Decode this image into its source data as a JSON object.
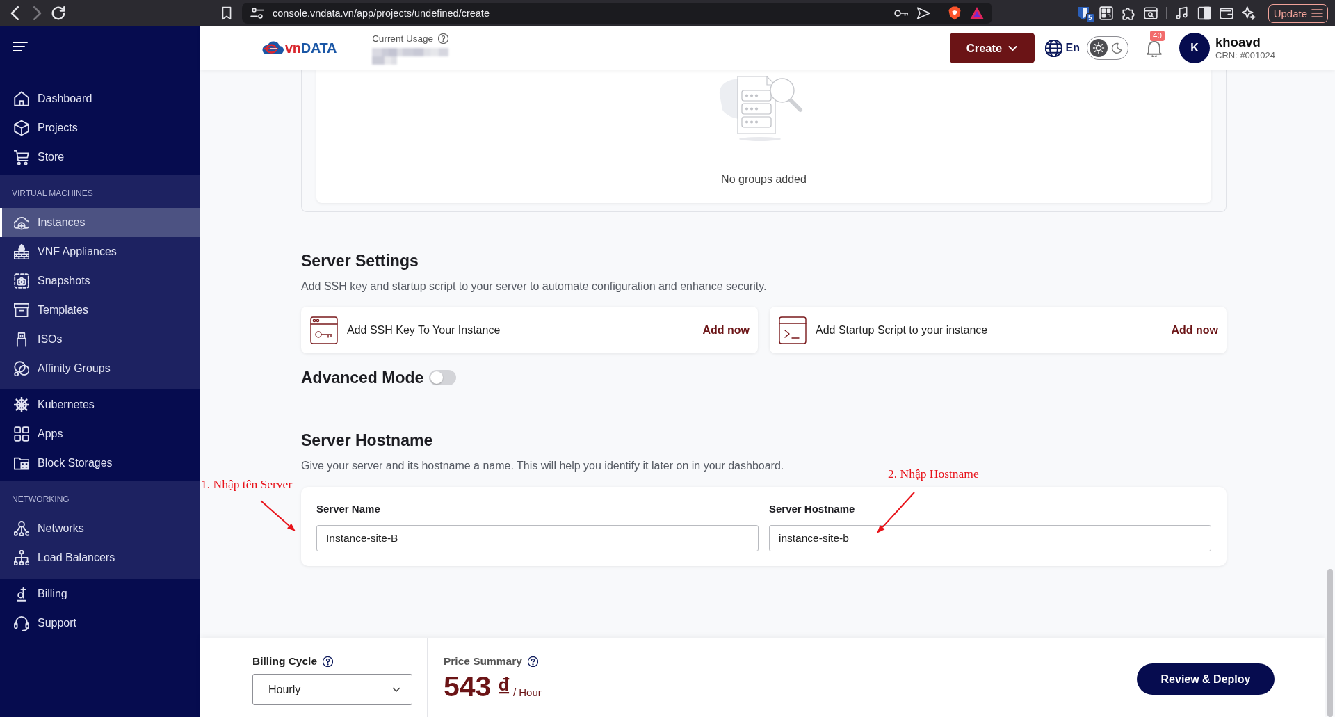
{
  "browser": {
    "nav": [
      {
        "kind": "back",
        "disabled": false
      },
      {
        "kind": "forward",
        "disabled": true
      },
      {
        "kind": "reload",
        "disabled": false
      }
    ],
    "url": "console.vndata.vn/app/projects/undefined/create",
    "extension_badge": "5",
    "update_button": "Update"
  },
  "header": {
    "logo_text": "vnDATA",
    "usage_label": "Current Usage",
    "create_button": "Create",
    "language": "En",
    "theme": [
      {
        "kind": "light",
        "selected": true
      },
      {
        "kind": "dark",
        "selected": false
      }
    ],
    "notification_count": "40",
    "user": {
      "initial": "K",
      "name": "khoavd",
      "crn": "CRN: #001024"
    }
  },
  "sidebar": {
    "groups": [
      {
        "items": [
          {
            "label": "Dashboard",
            "selected": false
          },
          {
            "label": "Projects",
            "selected": false
          },
          {
            "label": "Store",
            "selected": false
          }
        ]
      },
      {
        "title": "VIRTUAL MACHINES",
        "items": [
          {
            "label": "Instances",
            "selected": true
          },
          {
            "label": "VNF Appliances",
            "selected": false
          },
          {
            "label": "Snapshots",
            "selected": false
          },
          {
            "label": "Templates",
            "selected": false
          },
          {
            "label": "ISOs",
            "selected": false
          },
          {
            "label": "Affinity Groups",
            "selected": false
          }
        ]
      },
      {
        "items": [
          {
            "label": "Kubernetes",
            "selected": false
          },
          {
            "label": "Apps",
            "selected": false
          },
          {
            "label": "Block Storages",
            "selected": false
          }
        ]
      },
      {
        "title": "NETWORKING",
        "items": [
          {
            "label": "Networks",
            "selected": false
          },
          {
            "label": "Load Balancers",
            "selected": false
          }
        ]
      },
      {
        "items": [
          {
            "label": "Billing",
            "selected": false
          },
          {
            "label": "Support",
            "selected": false
          }
        ]
      }
    ]
  },
  "groups_panel": {
    "empty_text": "No groups added"
  },
  "server_settings": {
    "title": "Server Settings",
    "description": "Add SSH key and startup script to your server to automate configuration and enhance security.",
    "cards": [
      {
        "label": "Add SSH Key To Your Instance",
        "action": "Add now"
      },
      {
        "label": "Add Startup Script to your instance",
        "action": "Add now"
      }
    ],
    "advanced_mode": {
      "label": "Advanced Mode",
      "on": false
    }
  },
  "server_hostname": {
    "title": "Server Hostname",
    "description": "Give your server and its hostname a name. This will help you identify it later on in your dashboard.",
    "fields": [
      {
        "label": "Server Name",
        "value": "Instance-site-B"
      },
      {
        "label": "Server Hostname",
        "value": "instance-site-b"
      }
    ]
  },
  "annotations": [
    {
      "text": "1. Nhập tên Server"
    },
    {
      "text": "2. Nhập Hostname"
    }
  ],
  "footer": {
    "billing_cycle": {
      "label": "Billing Cycle",
      "value": "Hourly"
    },
    "price_summary": {
      "label": "Price Summary",
      "amount": "543",
      "currency": "₫",
      "unit": "/ Hour"
    },
    "deploy_button": "Review & Deploy"
  }
}
